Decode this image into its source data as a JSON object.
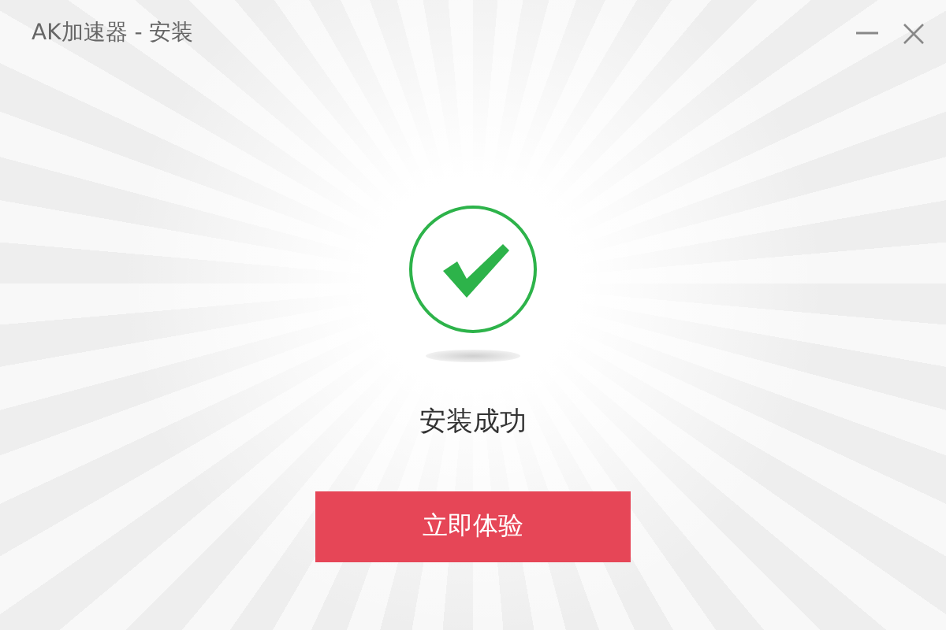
{
  "window": {
    "title": "AK加速器 - 安装"
  },
  "status": {
    "kind": "success",
    "message": "安装成功"
  },
  "buttons": [
    "立即体验"
  ]
}
